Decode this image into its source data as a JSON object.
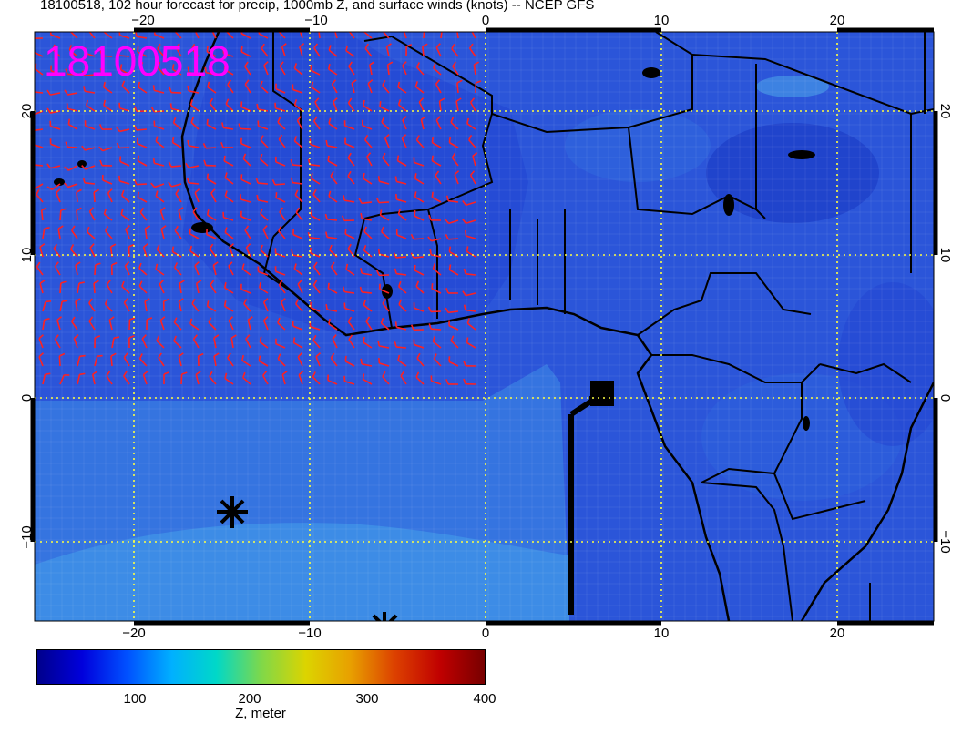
{
  "title": "18100518, 102 hour forecast for precip, 1000mb Z, and surface winds (knots) -- NCEP GFS",
  "stamp": "18100518",
  "map": {
    "region": "West and Central Africa / Gulf of Guinea",
    "x_axis": {
      "ticks": [
        "−20",
        "−10",
        "0",
        "10",
        "20"
      ]
    },
    "y_axis": {
      "ticks": [
        "20",
        "10",
        "0",
        "−10"
      ]
    },
    "lon_range": [
      -25.5,
      25.5
    ],
    "lat_range": [
      -15.5,
      25.5
    ],
    "graticule": "yellow dotted every 10 degrees",
    "wind_barb_color": "#ff2020",
    "field_colors": {
      "base": "#2850d8",
      "low": "#1c3cc8",
      "high": "#3a86e0"
    }
  },
  "colorbar": {
    "ticks": [
      "100",
      "200",
      "300",
      "400"
    ],
    "tick_values": [
      100,
      200,
      300,
      400
    ],
    "range": [
      25,
      400
    ],
    "unit": "Z, meter",
    "colors": [
      "#00008c",
      "#0000dc",
      "#0050ff",
      "#00b0ff",
      "#00d8c8",
      "#7ed84a",
      "#dcd400",
      "#e8a000",
      "#dc4000",
      "#c00000",
      "#780000"
    ]
  }
}
